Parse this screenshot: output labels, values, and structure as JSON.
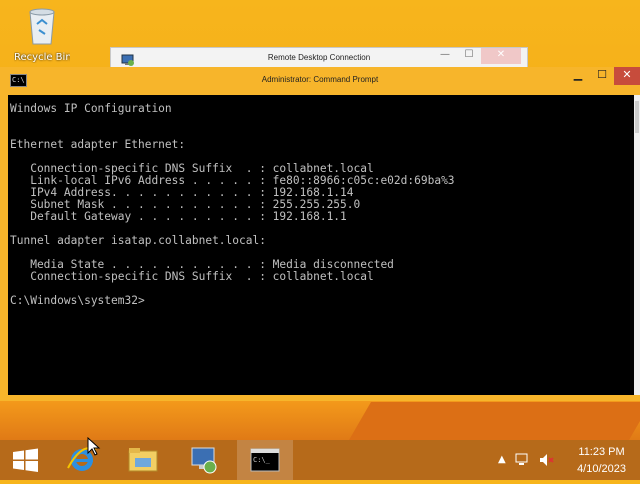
{
  "desktop": {
    "recycle_bin_label": "Recycle Bin"
  },
  "rdp_window": {
    "title": "Remote Desktop Connection"
  },
  "cmd_window": {
    "icon_text": "C:\\",
    "title": "Administrator: Command Prompt",
    "output": "Windows IP Configuration\n\n\nEthernet adapter Ethernet:\n\n   Connection-specific DNS Suffix  . : collabnet.local\n   Link-local IPv6 Address . . . . . : fe80::8966:c05c:e02d:69ba%3\n   IPv4 Address. . . . . . . . . . . : 192.168.1.14\n   Subnet Mask . . . . . . . . . . . : 255.255.255.0\n   Default Gateway . . . . . . . . . : 192.168.1.1\n\nTunnel adapter isatap.collabnet.local:\n\n   Media State . . . . . . . . . . . : Media disconnected\n   Connection-specific DNS Suffix  . : collabnet.local\n\nC:\\Windows\\system32>"
  },
  "taskbar": {
    "items": [
      "start-button",
      "internet-explorer",
      "file-explorer",
      "remote-desktop",
      "command-prompt"
    ],
    "active": "command-prompt"
  },
  "tray": {
    "time": "11:23 PM",
    "date": "4/10/2023"
  },
  "colors": {
    "desktop": "#f4a716",
    "console_bg": "#000000",
    "console_text": "#c0c0c0",
    "close_button": "#c74c3c"
  }
}
